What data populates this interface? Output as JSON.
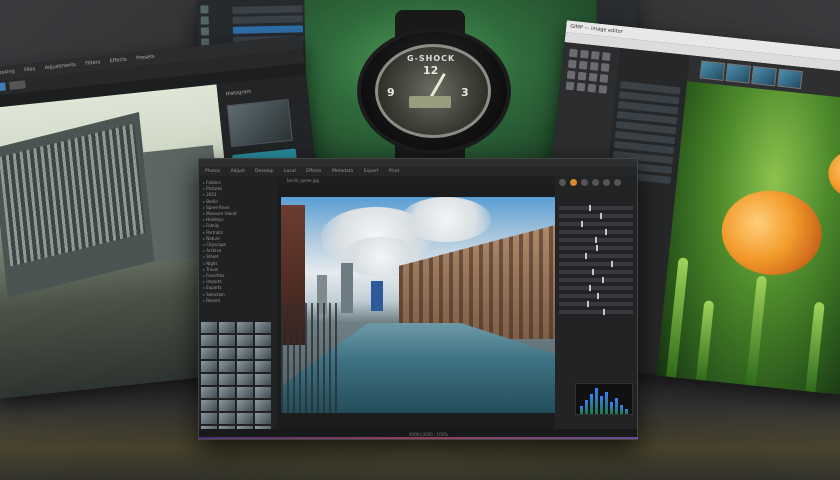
{
  "watch": {
    "brand": "G-SHOCK",
    "numerals": [
      "12",
      "3",
      "9"
    ]
  },
  "left_window": {
    "menu": [
      "Processing",
      "Files",
      "Adjustments",
      "Filters",
      "Effects",
      "Presets"
    ],
    "side_label": "Histogram"
  },
  "right_window": {
    "title": "GIMP — image editor"
  },
  "main_window": {
    "menu": [
      "Photos",
      "Adjust",
      "Develop",
      "Local",
      "Effects",
      "Metadata",
      "Export",
      "Print"
    ],
    "tree": [
      "Folders",
      "Pictures",
      "2023",
      "Berlin",
      "Spree River",
      "Museum Island",
      "Holidays",
      "Family",
      "Portraits",
      "Nature",
      "Cityscape",
      "Archive",
      "Street",
      "Night",
      "Travel",
      "Favorites",
      "Imports",
      "Exports",
      "Selection",
      "Recent"
    ],
    "viewer_caption": "berlin_spree.jpg",
    "status": "4000×3000  ·  100%"
  }
}
